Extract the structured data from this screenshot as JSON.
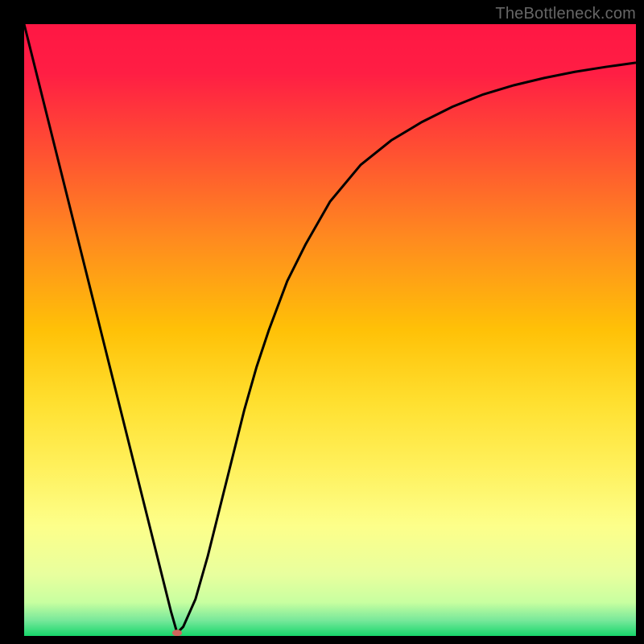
{
  "attribution": "TheBottleneck.com",
  "chart_data": {
    "type": "line",
    "title": "",
    "xlabel": "",
    "ylabel": "",
    "xlim": [
      0,
      100
    ],
    "ylim": [
      0,
      100
    ],
    "background_gradient": {
      "stops": [
        {
          "offset": 0.0,
          "color": "#ff1744"
        },
        {
          "offset": 0.08,
          "color": "#ff1e44"
        },
        {
          "offset": 0.2,
          "color": "#ff4d33"
        },
        {
          "offset": 0.35,
          "color": "#ff8a1f"
        },
        {
          "offset": 0.5,
          "color": "#ffc107"
        },
        {
          "offset": 0.62,
          "color": "#ffe030"
        },
        {
          "offset": 0.72,
          "color": "#fff05a"
        },
        {
          "offset": 0.82,
          "color": "#fdff8a"
        },
        {
          "offset": 0.9,
          "color": "#e8ff9e"
        },
        {
          "offset": 0.945,
          "color": "#c8ffa0"
        },
        {
          "offset": 0.975,
          "color": "#76e89a"
        },
        {
          "offset": 1.0,
          "color": "#17d66a"
        }
      ]
    },
    "series": [
      {
        "name": "curve",
        "color": "#000000",
        "x": [
          0,
          2,
          4,
          6,
          8,
          10,
          12,
          14,
          16,
          18,
          20,
          22,
          24,
          25,
          26,
          28,
          30,
          32,
          34,
          36,
          38,
          40,
          43,
          46,
          50,
          55,
          60,
          65,
          70,
          75,
          80,
          85,
          90,
          95,
          100
        ],
        "y": [
          100,
          92,
          84,
          76,
          68,
          60,
          52,
          44,
          36,
          28,
          20,
          12,
          4,
          0.5,
          1.5,
          6,
          13,
          21,
          29,
          37,
          44,
          50,
          58,
          64,
          71,
          77,
          81,
          84,
          86.5,
          88.5,
          90,
          91.2,
          92.2,
          93,
          93.7
        ]
      }
    ],
    "marker": {
      "x": 25,
      "y": 0.5,
      "color": "#d0655c",
      "rx": 6,
      "ry": 4
    }
  }
}
